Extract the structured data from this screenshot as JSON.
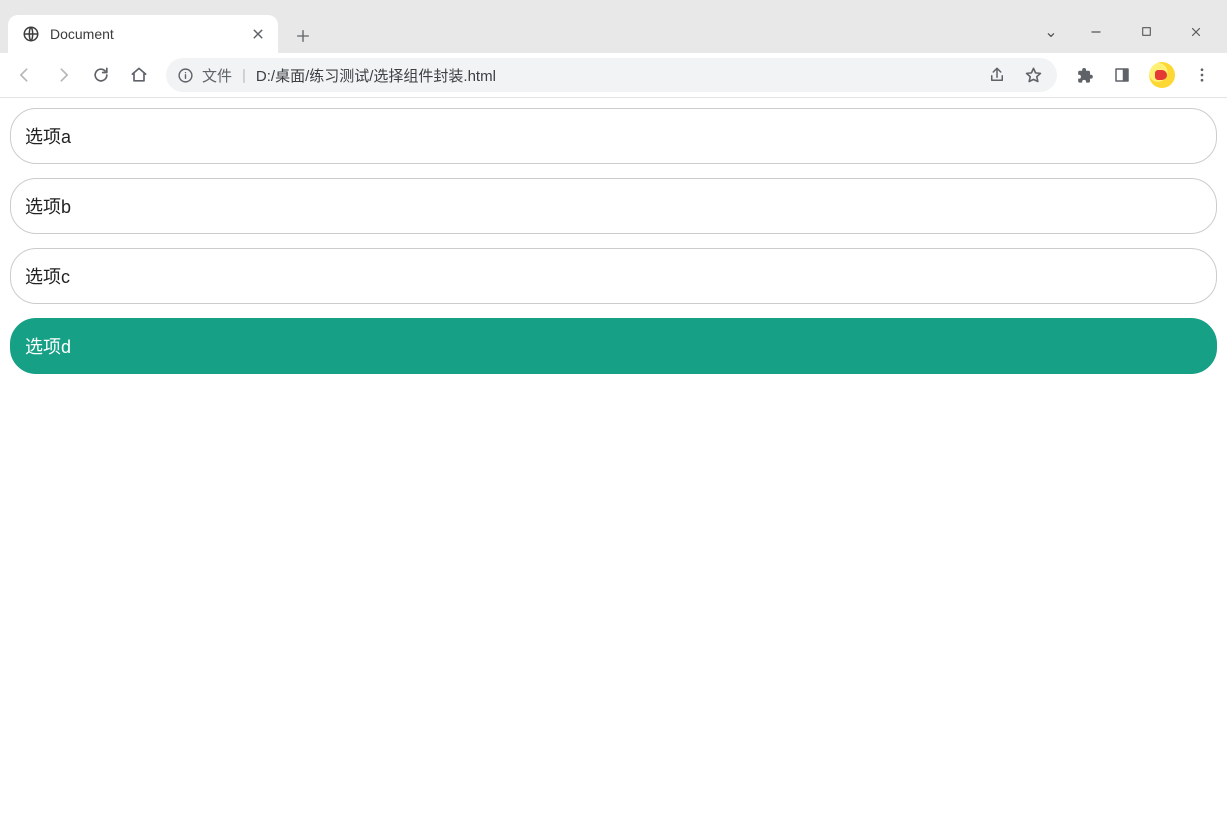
{
  "window": {
    "tab_title": "Document",
    "dropdown_glyph": "⌄",
    "minimize_glyph": "—",
    "maximize_glyph": "☐",
    "close_glyph": "✕"
  },
  "toolbar": {
    "scheme_label": "文件",
    "url_path": "D:/桌面/练习测试/选择组件封装.html"
  },
  "options": [
    {
      "id": "a",
      "label": "选项a",
      "selected": false
    },
    {
      "id": "b",
      "label": "选项b",
      "selected": false
    },
    {
      "id": "c",
      "label": "选项c",
      "selected": false
    },
    {
      "id": "d",
      "label": "选项d",
      "selected": true
    }
  ],
  "colors": {
    "accent": "#16a085"
  }
}
